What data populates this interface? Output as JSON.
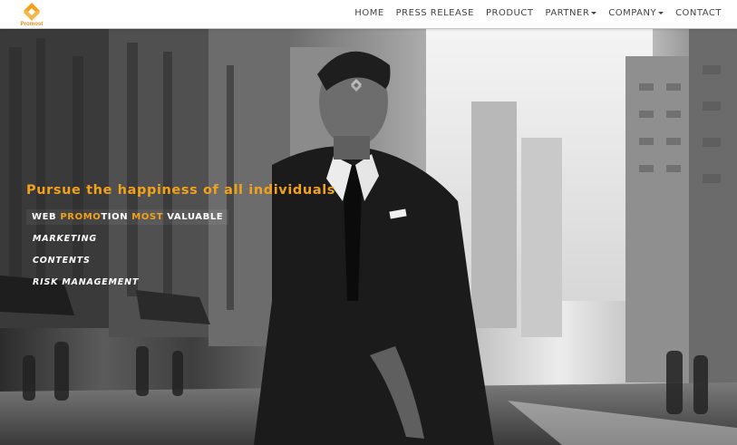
{
  "brand": {
    "logo_text": "Promost",
    "accent": "#f2a11a"
  },
  "nav": {
    "items": [
      {
        "label": "HOME",
        "dropdown": false
      },
      {
        "label": "PRESS RELEASE",
        "dropdown": false
      },
      {
        "label": "PRODUCT",
        "dropdown": false
      },
      {
        "label": "PARTNER",
        "dropdown": true
      },
      {
        "label": "COMPANY",
        "dropdown": true
      },
      {
        "label": "CONTACT",
        "dropdown": false
      }
    ]
  },
  "hero": {
    "tagline": "Pursue the happiness of all individuals",
    "subline": {
      "part1": "WEB ",
      "part2": "PROMO",
      "part3": "TION ",
      "part4": "MOST",
      "part5": " VALUABLE"
    },
    "services": [
      "MARKETING",
      "CONTENTS",
      "RISK MANAGEMENT"
    ]
  }
}
